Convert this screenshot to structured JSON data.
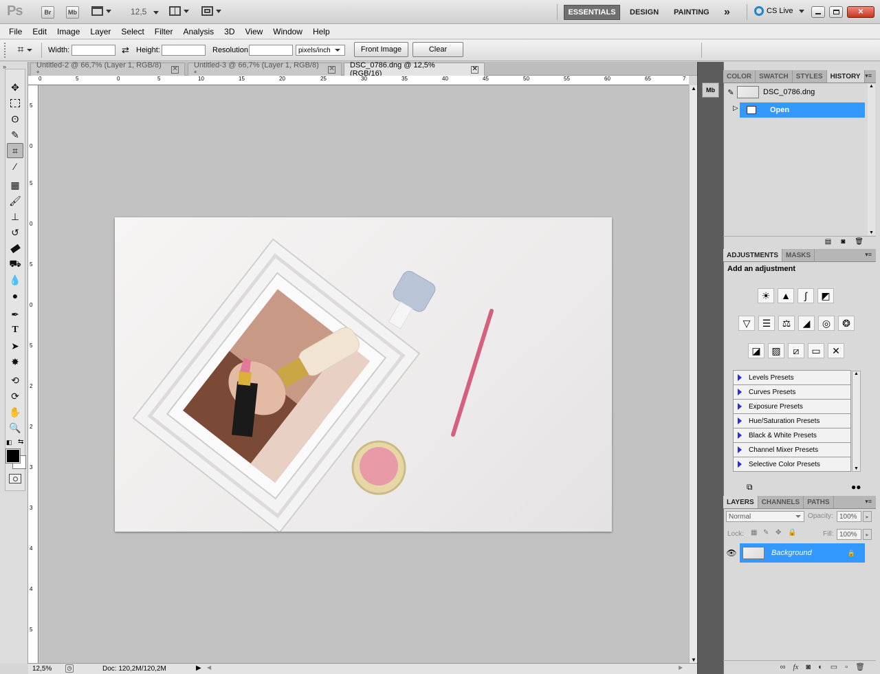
{
  "app": {
    "logo": "Ps",
    "bridge_label": "Br",
    "minibridge_label": "Mb",
    "zoom": "12,5",
    "workspaces": [
      "ESSENTIALS",
      "DESIGN",
      "PAINTING"
    ],
    "more_glyph": "»",
    "cs_live": "CS Live"
  },
  "menu": [
    "File",
    "Edit",
    "Image",
    "Layer",
    "Select",
    "Filter",
    "Analysis",
    "3D",
    "View",
    "Window",
    "Help"
  ],
  "options": {
    "width_label": "Width:",
    "height_label": "Height:",
    "resolution_label": "Resolution:",
    "unit": "pixels/inch",
    "front_image": "Front Image",
    "clear": "Clear"
  },
  "tabs": [
    {
      "title": "Untitled-2 @ 66,7% (Layer 1, RGB/8) *",
      "active": false
    },
    {
      "title": "Untitled-3 @ 66,7% (Layer 1, RGB/8) *",
      "active": false
    },
    {
      "title": "DSC_0786.dng @ 12,5% (RGB/16)",
      "active": true
    }
  ],
  "ruler": {
    "h": [
      "0",
      "5",
      "0",
      "5",
      "10",
      "15",
      "20",
      "25",
      "30",
      "35",
      "40",
      "45",
      "50",
      "55",
      "60",
      "65",
      "7"
    ],
    "v": [
      "5",
      "0",
      "5",
      "0",
      "5",
      "0",
      "5",
      "2",
      "2",
      "3",
      "3",
      "4",
      "4",
      "5"
    ]
  },
  "status": {
    "zoom": "12,5%",
    "doc": "Doc: 120,2M/120,2M"
  },
  "history": {
    "tabs": [
      "COLOR",
      "SWATCH",
      "STYLES",
      "HISTORY"
    ],
    "snapshot": "DSC_0786.dng",
    "steps": [
      "Open"
    ]
  },
  "adjustments": {
    "tabs": [
      "ADJUSTMENTS",
      "MASKS"
    ],
    "heading": "Add an adjustment",
    "presets": [
      "Levels Presets",
      "Curves Presets",
      "Exposure Presets",
      "Hue/Saturation Presets",
      "Black & White Presets",
      "Channel Mixer Presets",
      "Selective Color Presets"
    ]
  },
  "layers": {
    "tabs": [
      "LAYERS",
      "CHANNELS",
      "PATHS"
    ],
    "blend": "Normal",
    "opacity_label": "Opacity:",
    "opacity": "100%",
    "lock_label": "Lock:",
    "fill_label": "Fill:",
    "fill": "100%",
    "items": [
      "Background"
    ]
  },
  "colors": {
    "selection": "#3399ff",
    "active_workspace": "#707070"
  }
}
